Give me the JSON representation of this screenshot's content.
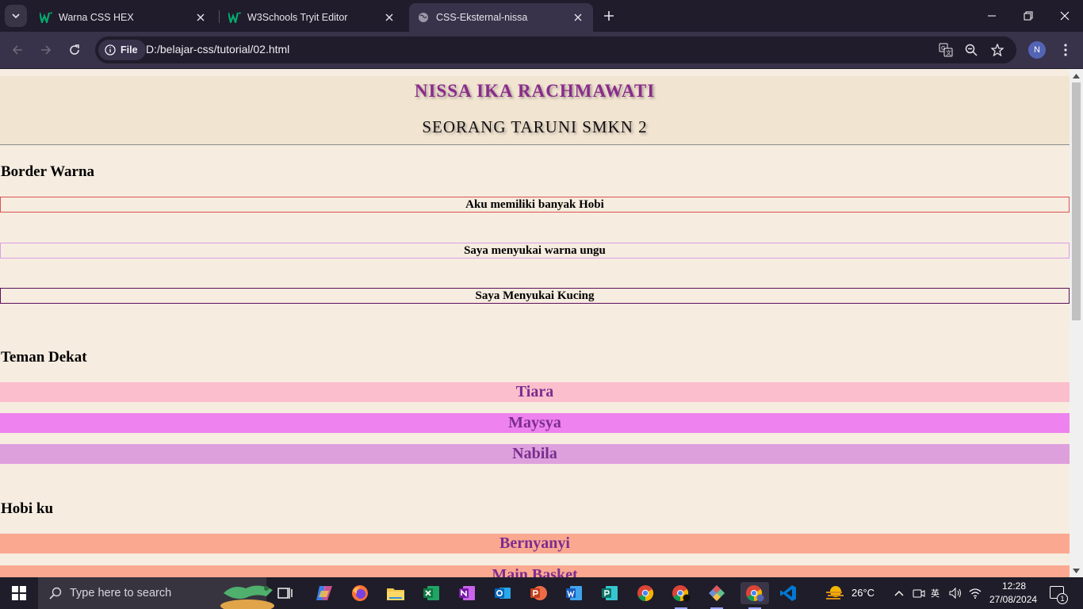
{
  "browser": {
    "tabs": [
      {
        "title": "Warna CSS HEX",
        "favicon": "w3schools-icon",
        "active": false
      },
      {
        "title": "W3Schools Tryit Editor",
        "favicon": "w3schools-icon",
        "active": false
      },
      {
        "title": "CSS-Eksternal-nissa",
        "favicon": "globe-icon",
        "active": true
      }
    ],
    "address": {
      "scheme_chip": "File",
      "url": "D:/belajar-css/tutorial/02.html"
    },
    "profile_initial": "N"
  },
  "page": {
    "header_title": "NISSA IKA RACHMAWATI",
    "header_subtitle": "SEORANG TARUNI SMKN 2",
    "sections": {
      "border": {
        "title": "Border Warna",
        "boxes": [
          {
            "text": "Aku memiliki banyak Hobi",
            "border_color": "#d9534f"
          },
          {
            "text": "Saya menyukai warna ungu",
            "border_color": "#da9ee8"
          },
          {
            "text": "Saya Menyukai Kucing",
            "border_color": "#5b0f5b"
          }
        ]
      },
      "friends": {
        "title": "Teman Dekat",
        "items": [
          {
            "name": "Tiara",
            "bg": "#fbbecd"
          },
          {
            "name": "Maysya",
            "bg": "#ee82ee"
          },
          {
            "name": "Nabila",
            "bg": "#dda0dd"
          }
        ]
      },
      "hobbies": {
        "title": "Hobi ku",
        "items": [
          {
            "name": "Bernyanyi",
            "bg": "#fba891"
          },
          {
            "name": "Main Basket",
            "bg": "#fba891"
          }
        ]
      }
    },
    "colors": {
      "page_bg": "#f6ece0",
      "header_bg": "#f1e5d1",
      "accent_purple": "#8a2b8c"
    }
  },
  "taskbar": {
    "search_placeholder": "Type here to search",
    "weather": "26°C",
    "time": "12:28",
    "date": "27/08/2024",
    "notification_count": "1",
    "apps": [
      "task-view-icon",
      "copilot-icon",
      "firefox-icon",
      "file-explorer-icon",
      "excel-icon",
      "onenote-icon",
      "outlook-icon",
      "powerpoint-icon",
      "word-icon",
      "publisher-icon",
      "chrome-icon",
      "chrome-profile-icon",
      "git-icon",
      "chrome-active-icon",
      "vscode-icon"
    ]
  }
}
